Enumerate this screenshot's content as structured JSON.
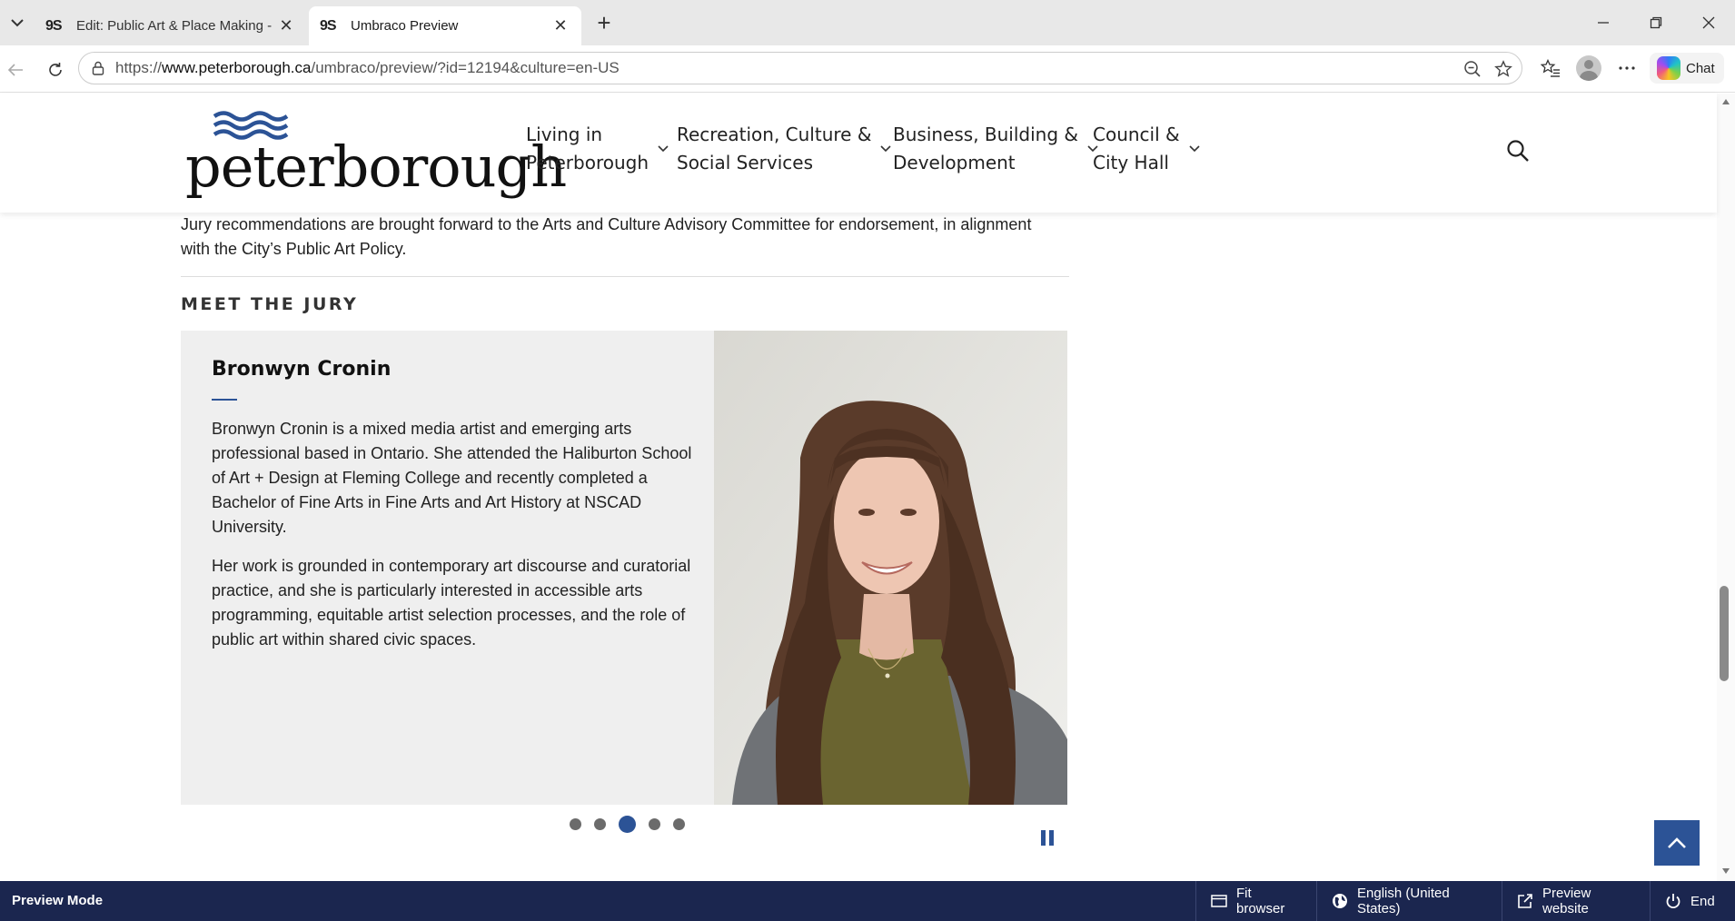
{
  "browser": {
    "tabs": [
      {
        "favicon": "9S",
        "title": "Edit: Public Art & Place Making - C",
        "active": false
      },
      {
        "favicon": "9S",
        "title": "Umbraco Preview",
        "active": true
      }
    ],
    "url": {
      "scheme": "https://",
      "host": "www.peterborough.ca",
      "path": "/umbraco/preview/?id=12194&culture=en-US"
    },
    "chat_label": "Chat"
  },
  "site": {
    "logo_text": "peterborough",
    "nav": [
      {
        "label": "Living in\nPeterborough"
      },
      {
        "label": "Recreation, Culture &\nSocial Services"
      },
      {
        "label": "Business, Building &\nDevelopment"
      },
      {
        "label": "Council &\nCity Hall"
      }
    ]
  },
  "main": {
    "intro": "Jury recommendations are brought forward to the Arts and Culture Advisory Committee for endorsement, in alignment with the City’s Public Art Policy.",
    "section_title": "MEET THE JURY",
    "jury_card": {
      "name": "Bronwyn Cronin",
      "bio": [
        "Bronwyn Cronin is a mixed media artist and emerging arts professional based in Ontario. She attended the Haliburton School of Art + Design at Fleming College and recently completed a Bachelor of Fine Arts in Fine Arts and Art History at NSCAD University.",
        "Her work is grounded in contemporary art discourse and curatorial practice, and she is particularly interested in accessible arts programming, equitable artist selection processes, and the role of public art within shared civic spaces."
      ]
    },
    "carousel": {
      "slide_count": 5,
      "active_index": 2
    }
  },
  "preview_bar": {
    "mode_label": "Preview Mode",
    "fit_browser": "Fit browser",
    "language": "English (United States)",
    "preview_website": "Preview website",
    "end": "End"
  },
  "colors": {
    "brand_blue": "#2c5396",
    "preview_bar": "#1b264f"
  }
}
